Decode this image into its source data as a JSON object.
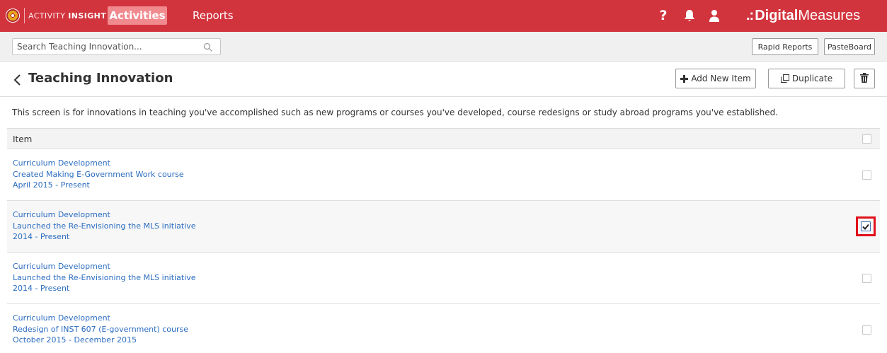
{
  "app": {
    "brand_prefix": "ACTIVITY",
    "brand_name": "INSIGHT",
    "vendor_dots": ".:",
    "vendor_bold": "Digital",
    "vendor_thin": "Measures"
  },
  "nav": {
    "activities_label": "Activities",
    "reports_label": "Reports",
    "help_label": "?"
  },
  "search": {
    "placeholder": "Search Teaching Innovation...",
    "value": ""
  },
  "toolbar": {
    "rapid_reports_label": "Rapid Reports",
    "pasteboard_label": "PasteBoard",
    "add_new_label": "Add New Item",
    "duplicate_label": "Duplicate"
  },
  "page": {
    "title": "Teaching Innovation",
    "description": "This screen is for innovations in teaching you've accomplished such as new programs or courses you've developed, course redesigns or study abroad programs you've established."
  },
  "table": {
    "header_label": "Item",
    "rows": [
      {
        "line1": "Curriculum Development",
        "line2": "Created Making E-Government Work course",
        "line3": "April 2015 - Present",
        "checked": false
      },
      {
        "line1": "Curriculum Development",
        "line2": "Launched the Re-Envisioning the MLS initiative",
        "line3": "2014 - Present",
        "checked": true
      },
      {
        "line1": "Curriculum Development",
        "line2": "Launched the Re-Envisioning the MLS initiative",
        "line3": "2014 - Present",
        "checked": false
      },
      {
        "line1": "Curriculum Development",
        "line2": "Redesign of INST 607 (E-government) course",
        "line3": "October 2015 - December 2015",
        "checked": false
      }
    ]
  },
  "colors": {
    "topbar": "#d2343e",
    "active_tab": "#f08a8f",
    "link": "#2a6cc0",
    "highlight": "#e0101a"
  }
}
